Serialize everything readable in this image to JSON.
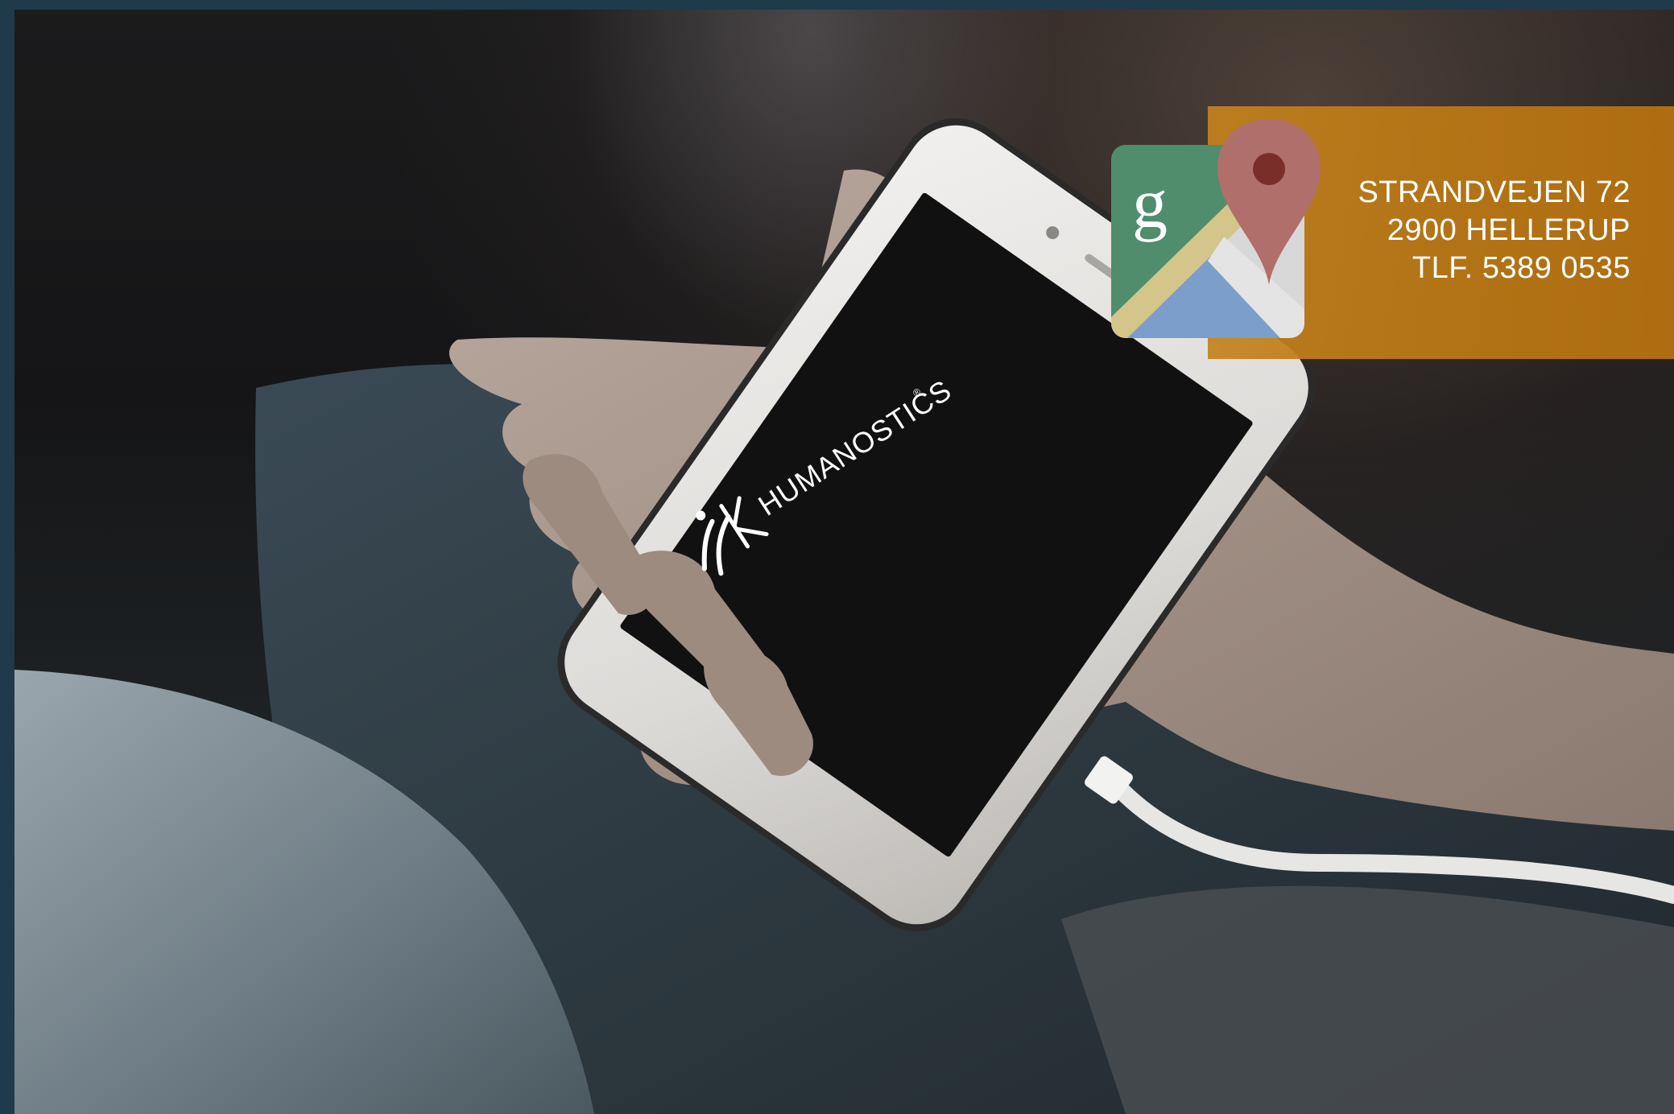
{
  "logo": {
    "wordmark": "HUMANOSTICS",
    "trademark": "®"
  },
  "maps_icon": {
    "icon": "google-maps-icon",
    "letter": "g"
  },
  "contact": {
    "street": "STRANDVEJEN 72",
    "city": "2900 HELLERUP",
    "phone": "TLF. 5389 0535"
  },
  "colors": {
    "frame": "#1f3a4b",
    "banner": "#c0801a",
    "text": "#ffffff"
  }
}
